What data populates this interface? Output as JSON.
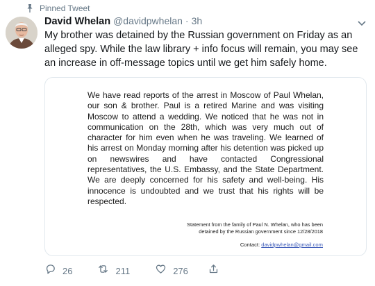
{
  "pinned": {
    "label": "Pinned Tweet",
    "icon": "pin-icon"
  },
  "author": {
    "display_name": "David Whelan",
    "handle": "@davidpwhelan",
    "separator": "·",
    "timestamp": "3h"
  },
  "tweet": {
    "text": "My brother was detained by the Russian government on Friday as an alleged spy. While the law library + info focus will remain, you may see an increase in off-message topics until we get him safely home."
  },
  "media": {
    "statement": "We have read reports of the arrest in Moscow of Paul Whelan, our son & brother.  Paul is a retired Marine and was visiting Moscow to attend a  wedding.  We noticed that he was not in communication on the 28th, which was very much out of character for him even when he was traveling. We learned of his arrest on Monday morning after his detention was picked up on newswires and have contacted Congressional representatives, the U.S. Embassy, and the State Department. We are deeply concerned for his safety and well-being. His innocence is undoubted and we trust that his rights will be respected.",
    "source": "Statement from the family of Paul N. Whelan, who has been detained by the Russian government since 12/28/2018",
    "contact_label": "Contact:",
    "contact_email": "davidpwhelan@gmail.com"
  },
  "actions": {
    "reply_count": "26",
    "retweet_count": "211",
    "like_count": "276",
    "icons": [
      "reply-icon",
      "retweet-icon",
      "like-icon",
      "share-icon"
    ]
  },
  "colors": {
    "secondary_text": "#657786",
    "border": "#e1e8ed",
    "link": "#3b5ab8"
  }
}
